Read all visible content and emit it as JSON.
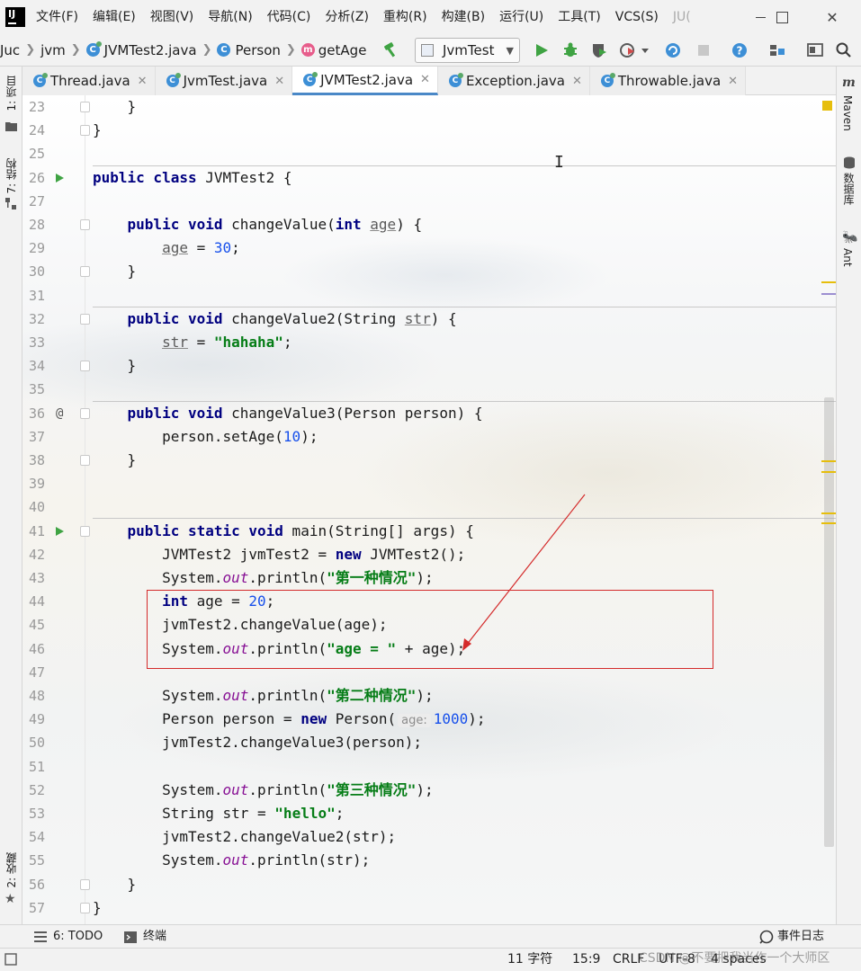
{
  "app": {
    "logo_text": "IJ",
    "menu": [
      "文件(F)",
      "编辑(E)",
      "视图(V)",
      "导航(N)",
      "代码(C)",
      "分析(Z)",
      "重构(R)",
      "构建(B)",
      "运行(U)",
      "工具(T)",
      "VCS(S)",
      "JU("
    ]
  },
  "breadcrumbs": [
    "Juc",
    "jvm",
    "JVMTest2.java",
    "Person",
    "getAge"
  ],
  "run_config": "JvmTest",
  "tabs": [
    {
      "label": "Thread.java",
      "active": false
    },
    {
      "label": "JvmTest.java",
      "active": false
    },
    {
      "label": "JVMTest2.java",
      "active": true
    },
    {
      "label": "Exception.java",
      "active": false
    },
    {
      "label": "Throwable.java",
      "active": false
    }
  ],
  "left_tools": [
    "1: 项目",
    "7: 结构",
    "2: 收藏"
  ],
  "right_tools": [
    "Maven",
    "数据库",
    "Ant"
  ],
  "code_lines": [
    {
      "n": "23",
      "fold": true,
      "html": "    }"
    },
    {
      "n": "24",
      "fold": true,
      "html": "}"
    },
    {
      "n": "25",
      "html": ""
    },
    {
      "n": "26",
      "run": true,
      "html": "<span class='kw'>public class</span> JVMTest2 {"
    },
    {
      "n": "27",
      "html": ""
    },
    {
      "n": "28",
      "fold": true,
      "html": "    <span class='kw'>public void</span> changeValue(<span class='kw'>int</span> <span class='param'>age</span>) {"
    },
    {
      "n": "29",
      "html": "        <span class='param'>age</span> = <span class='num'>30</span>;"
    },
    {
      "n": "30",
      "fold": true,
      "html": "    }"
    },
    {
      "n": "31",
      "html": ""
    },
    {
      "n": "32",
      "fold": true,
      "html": "    <span class='kw'>public void</span> changeValue2(String <span class='param'>str</span>) {"
    },
    {
      "n": "33",
      "html": "        <span class='param'>str</span> = <span class='str'>\"hahaha\"</span>;"
    },
    {
      "n": "34",
      "fold": true,
      "html": "    }"
    },
    {
      "n": "35",
      "html": ""
    },
    {
      "n": "36",
      "at": true,
      "fold": true,
      "html": "    <span class='kw'>public void</span> changeValue3(Person person) {"
    },
    {
      "n": "37",
      "html": "        person.setAge(<span class='num'>10</span>);"
    },
    {
      "n": "38",
      "fold": true,
      "html": "    }"
    },
    {
      "n": "39",
      "html": ""
    },
    {
      "n": "40",
      "html": ""
    },
    {
      "n": "41",
      "run": true,
      "fold": true,
      "html": "    <span class='kw'>public static void</span> main(String[] args) {"
    },
    {
      "n": "42",
      "html": "        JVMTest2 jvmTest2 = <span class='kw'>new</span> JVMTest2();"
    },
    {
      "n": "43",
      "html": "        System.<span class='fld'>out</span>.println(<span class='str'>\"第一种情况\"</span>);"
    },
    {
      "n": "44",
      "html": "        <span class='kw'>int</span> age = <span class='num'>20</span>;"
    },
    {
      "n": "45",
      "html": "        jvmTest2.changeValue(age);"
    },
    {
      "n": "46",
      "html": "        System.<span class='fld'>out</span>.println(<span class='str'>\"age = \"</span> + age);"
    },
    {
      "n": "47",
      "html": ""
    },
    {
      "n": "48",
      "html": "        System.<span class='fld'>out</span>.println(<span class='str'>\"第二种情况\"</span>);"
    },
    {
      "n": "49",
      "html": "        Person person = <span class='kw'>new</span> Person(<span class='hint'>age:</span><span class='num'>1000</span>);"
    },
    {
      "n": "50",
      "html": "        jvmTest2.changeValue3(person);"
    },
    {
      "n": "51",
      "html": ""
    },
    {
      "n": "52",
      "html": "        System.<span class='fld'>out</span>.println(<span class='str'>\"第三种情况\"</span>);"
    },
    {
      "n": "53",
      "html": "        String str = <span class='str'>\"hello\"</span>;"
    },
    {
      "n": "54",
      "html": "        jvmTest2.changeValue2(str);"
    },
    {
      "n": "55",
      "html": "        System.<span class='fld'>out</span>.println(str);"
    },
    {
      "n": "56",
      "fold": true,
      "html": "    }"
    },
    {
      "n": "57",
      "fold": true,
      "html": "}"
    }
  ],
  "bottom_tools": {
    "todo": "6: TODO",
    "terminal": "终端",
    "event_log": "事件日志"
  },
  "status": {
    "chars": "11 字符",
    "position": "15:9",
    "line_sep": "CRLF",
    "encoding": "UTF-8",
    "indent": "4 spaces"
  },
  "watermark": "CSDN @不要把我当作一个大师区",
  "colors": {
    "keyword": "#000080",
    "string": "#067d17",
    "number": "#1750eb",
    "field": "#871094",
    "annotation": "#d42a2a",
    "run": "#3fa343"
  }
}
